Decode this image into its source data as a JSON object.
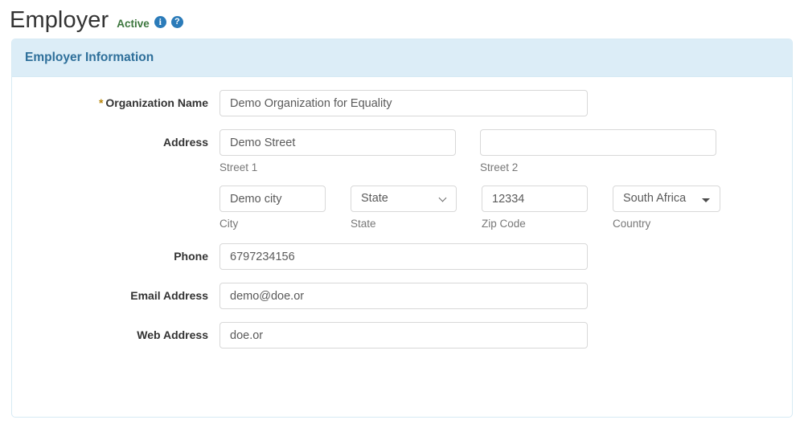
{
  "header": {
    "title": "Employer",
    "status": "Active",
    "info_icon": "info-circle-icon",
    "help_icon": "help-circle-icon"
  },
  "panel": {
    "title": "Employer Information"
  },
  "form": {
    "organization_name": {
      "label": "Organization Name",
      "required_marker": "*",
      "value": "Demo Organization for Equality"
    },
    "address": {
      "label": "Address",
      "street1": {
        "value": "Demo Street",
        "sub_label": "Street 1"
      },
      "street2": {
        "value": "",
        "sub_label": "Street 2"
      },
      "city": {
        "value": "Demo city",
        "sub_label": "City"
      },
      "state": {
        "value": "State",
        "sub_label": "State"
      },
      "zip": {
        "value": "12334",
        "sub_label": "Zip Code"
      },
      "country": {
        "value": "South Africa",
        "sub_label": "Country"
      }
    },
    "phone": {
      "label": "Phone",
      "value": "6797234156"
    },
    "email": {
      "label": "Email Address",
      "value": "demo@doe.or"
    },
    "web": {
      "label": "Web Address",
      "value": "doe.or"
    }
  },
  "colors": {
    "panel_header_bg": "#dcedf7",
    "panel_header_text": "#2e6f9a",
    "status_green": "#3c763d",
    "icon_blue": "#2b7bb9",
    "required_star": "#b8860b",
    "card_border": "#d6eaf4"
  }
}
